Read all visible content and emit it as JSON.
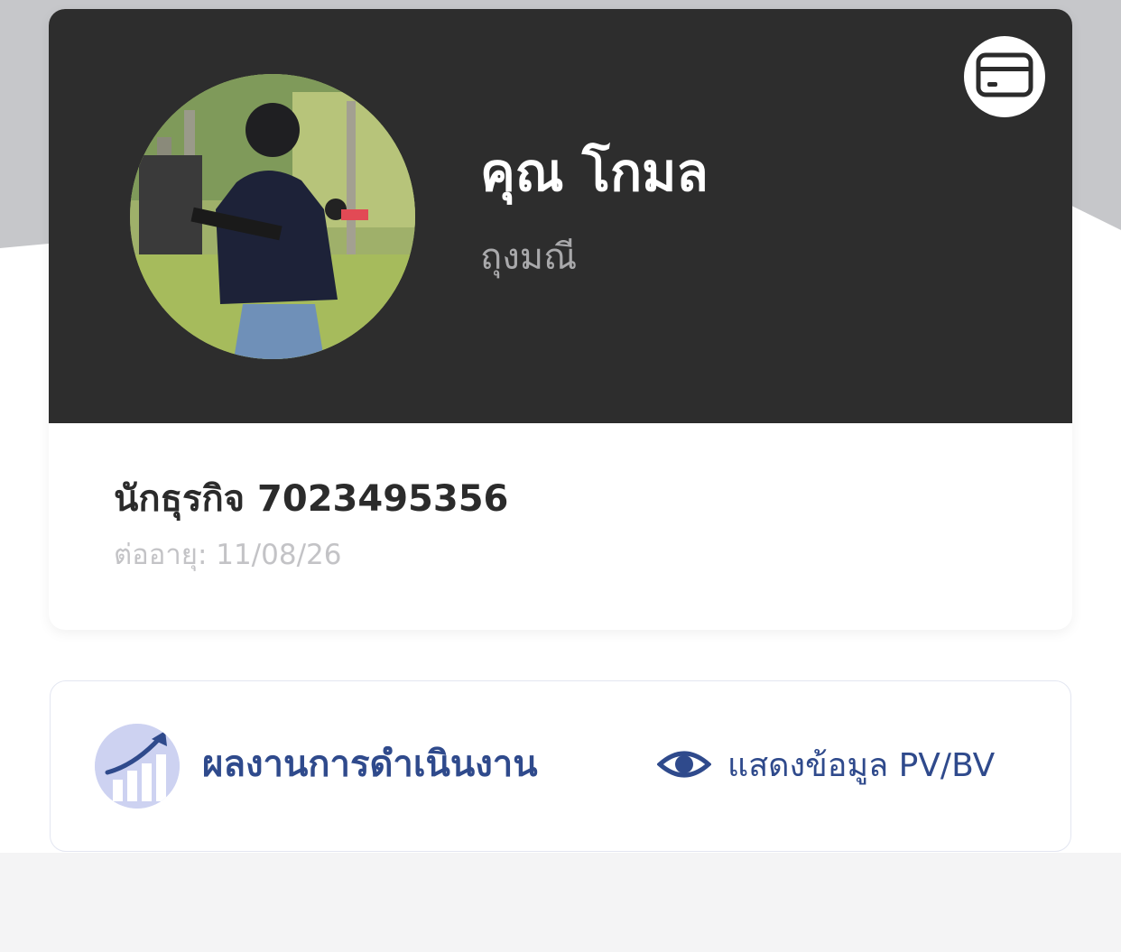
{
  "profile": {
    "name": "คุณ โกมล",
    "surname": "ถุงมณี",
    "member_label": "นักธุรกิจ 7023495356",
    "expire_label": "ต่ออายุ: 11/08/26",
    "card_button_icon": "credit-card-icon",
    "avatar_icon": "profile-photo"
  },
  "performance": {
    "title": "ผลงานการดำเนินงาน",
    "icon": "chart-growth-icon",
    "toggle_icon": "eye-icon",
    "toggle_label": "แสดงข้อมูล PV/BV"
  },
  "colors": {
    "header_bg": "#2d2d2d",
    "accent_blue": "#2f4a8c",
    "icon_bg": "#cdd2f1"
  }
}
